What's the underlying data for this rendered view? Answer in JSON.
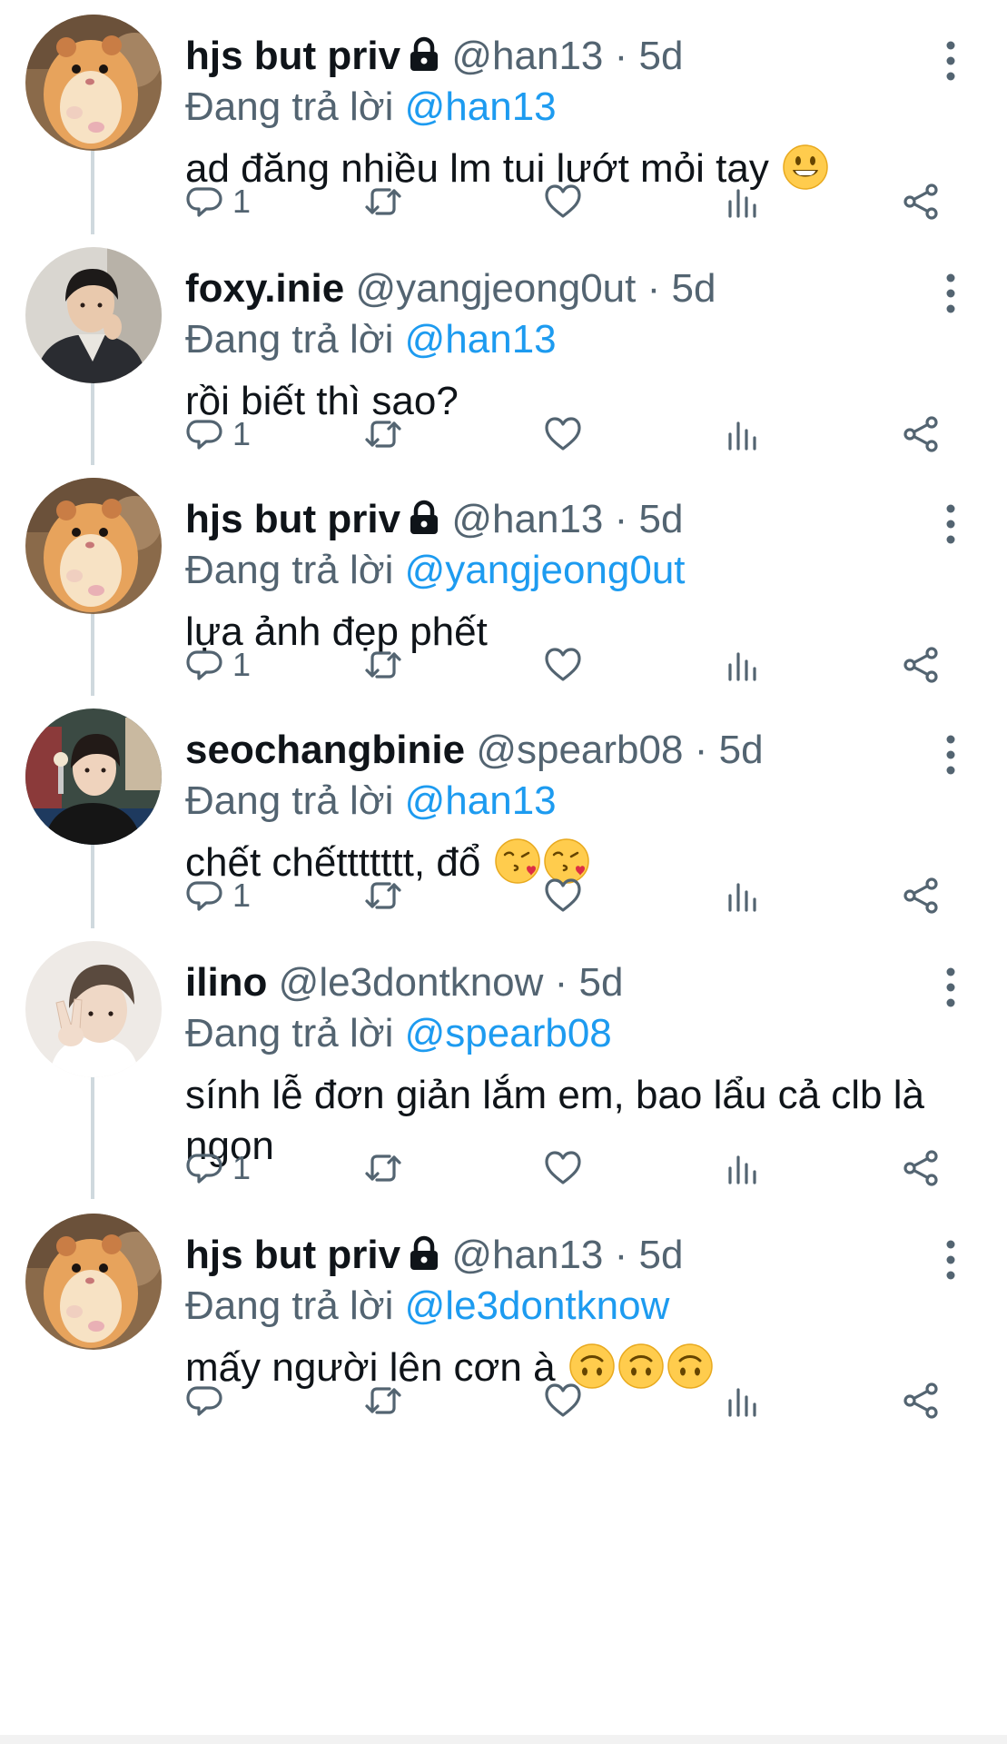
{
  "replying_prefix": "Đang trả lời",
  "tweets": [
    {
      "name": "hjs but priv",
      "locked": true,
      "handle": "@han13",
      "separator": "·",
      "time": "5d",
      "reply_to": "@han13",
      "text": "ad đăng nhiều lm tui lướt mỏi tay",
      "emoji": [
        "grinning-face"
      ],
      "reply_count": "1",
      "avatar": "hamster"
    },
    {
      "name": "foxy.inie",
      "locked": false,
      "handle": "@yangjeong0ut",
      "separator": "·",
      "time": "5d",
      "reply_to": "@han13",
      "text": "rồi biết thì sao?",
      "emoji": [],
      "reply_count": "1",
      "avatar": "person-dark-jacket"
    },
    {
      "name": "hjs but priv",
      "locked": true,
      "handle": "@han13",
      "separator": "·",
      "time": "5d",
      "reply_to": "@yangjeong0ut",
      "text": "lựa ảnh đẹp phết",
      "emoji": [],
      "reply_count": "1",
      "avatar": "hamster"
    },
    {
      "name": "seochangbinie",
      "locked": false,
      "handle": "@spearb08",
      "separator": "·",
      "time": "5d",
      "reply_to": "@han13",
      "text": "chết chếttttttt, đổ",
      "emoji": [
        "face-blowing-kiss",
        "face-blowing-kiss"
      ],
      "reply_count": "1",
      "avatar": "person-train"
    },
    {
      "name": "ilino",
      "locked": false,
      "handle": "@le3dontknow",
      "separator": "·",
      "time": "5d",
      "reply_to": "@spearb08",
      "text": "sính lễ đơn giản lắm em, bao lẩu cả clb là ngon",
      "emoji": [],
      "reply_count": "1",
      "avatar": "person-peace-sign"
    },
    {
      "name": "hjs but priv",
      "locked": true,
      "handle": "@han13",
      "separator": "·",
      "time": "5d",
      "reply_to": "@le3dontknow",
      "text": "mấy người lên cơn à",
      "emoji": [
        "upside-down-face",
        "upside-down-face",
        "upside-down-face"
      ],
      "reply_count": "",
      "avatar": "hamster"
    }
  ],
  "icons": {
    "reply": "reply-icon",
    "retweet": "retweet-icon",
    "like": "heart-icon",
    "views": "views-icon",
    "share": "share-icon",
    "more": "more-options-icon",
    "lock": "lock-icon"
  },
  "colors": {
    "link": "#1d9bf0",
    "muted": "#536471",
    "text": "#0f1419",
    "thread_line": "#cfd9de"
  }
}
